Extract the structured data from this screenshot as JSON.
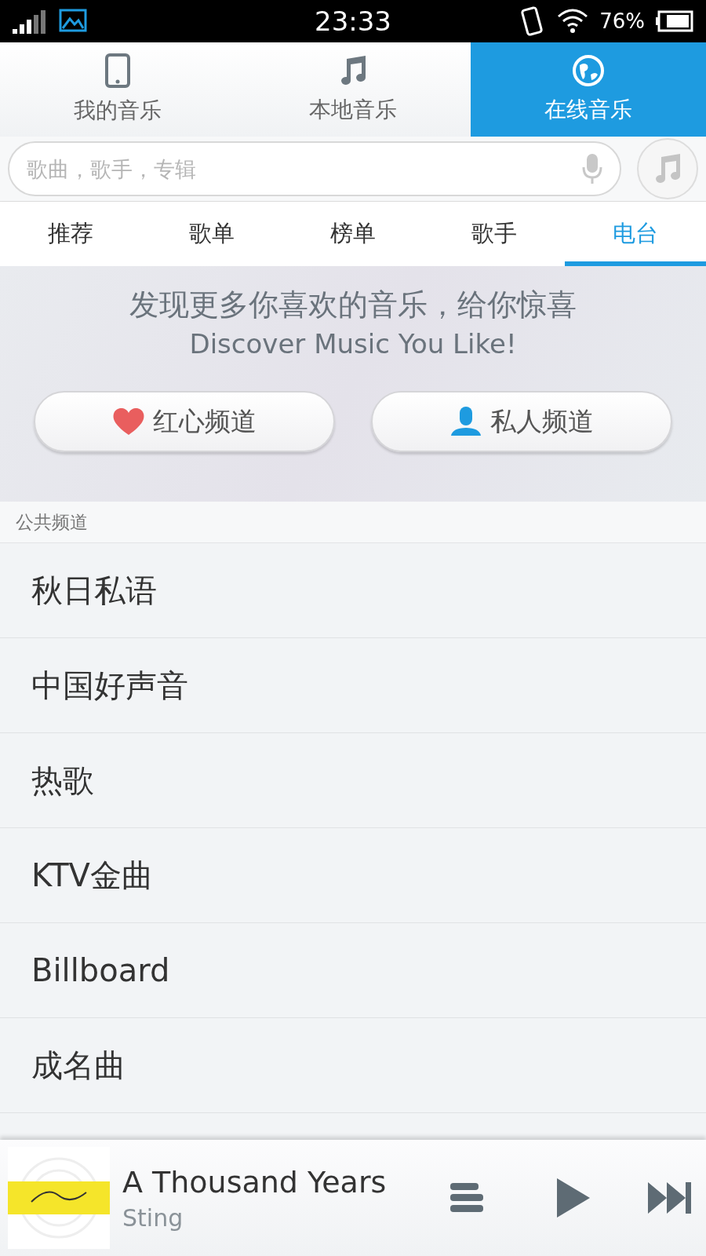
{
  "status_bar": {
    "time": "23:33",
    "battery": "76%"
  },
  "main_tabs": [
    {
      "label": "我的音乐",
      "kind": "phone",
      "selected": false
    },
    {
      "label": "本地音乐",
      "kind": "note",
      "selected": false
    },
    {
      "label": "在线音乐",
      "kind": "globe",
      "selected": true
    }
  ],
  "search": {
    "placeholder": "歌曲，歌手，专辑"
  },
  "sub_tabs": [
    {
      "label": "推荐",
      "selected": false
    },
    {
      "label": "歌单",
      "selected": false
    },
    {
      "label": "榜单",
      "selected": false
    },
    {
      "label": "歌手",
      "selected": false
    },
    {
      "label": "电台",
      "selected": true
    }
  ],
  "banner": {
    "title": "发现更多你喜欢的音乐，给你惊喜",
    "subtitle": "Discover Music You Like!",
    "buttons": [
      {
        "label": "红心频道",
        "kind": "heart"
      },
      {
        "label": "私人频道",
        "kind": "person"
      }
    ]
  },
  "section": {
    "title": "公共频道",
    "items": [
      "秋日私语",
      "中国好声音",
      "热歌",
      "KTV金曲",
      "Billboard",
      "成名曲"
    ]
  },
  "player": {
    "title": "A Thousand Years",
    "artist": "Sting"
  }
}
